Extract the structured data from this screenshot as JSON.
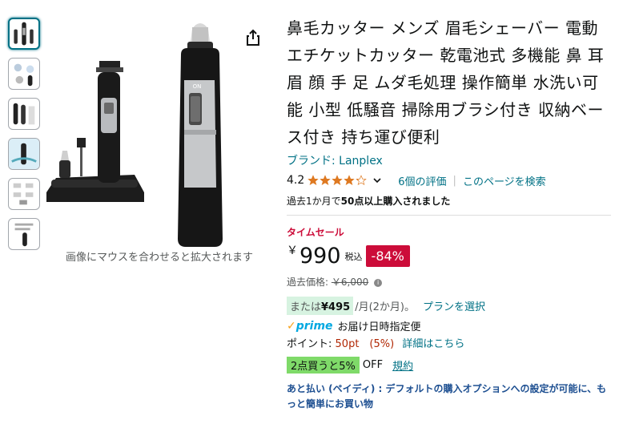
{
  "gallery": {
    "thumbnail_count": 6,
    "hover_note": "画像にマウスを合わせると拡大されます"
  },
  "product": {
    "title": "鼻毛カッター メンズ 眉毛シェーバー 電動 エチケットカッター 乾電池式 多機能 鼻 耳 眉 顔 手 足 ムダ毛処理 操作簡単 水洗い可能 小型 低騒音 掃除用ブラシ付き 収納ベース付き 持ち運び便利",
    "brand_link": "ブランド: Lanplex",
    "rating_value": "4.2",
    "rating_stars": 4.2,
    "reviews_link": "6個の評価",
    "separator": "|",
    "search_page_link": "このページを検索",
    "bought_prefix": "過去1か月で",
    "bought_bold": "50点以上購入されました"
  },
  "pricing": {
    "deal_label": "タイムセール",
    "currency": "￥",
    "price": "990",
    "tax_label": "税込",
    "discount": "-84%",
    "list_price_label": "過去価格:",
    "list_price": "￥6,000",
    "installment_prefix": "または",
    "installment_amount": "¥495",
    "installment_suffix": "/月(2か月)。",
    "plan_link": "プランを選択",
    "prime_label": "prime",
    "delivery_text": "お届け日時指定便",
    "points_label": "ポイント:",
    "points_value": "50pt　(5%)",
    "points_link": "詳細はこちら",
    "coupon_label": "2点買うと5%",
    "coupon_off": "OFF",
    "coupon_terms": "規約",
    "paidy_text": "あと払い (ペイディ) : デフォルトの購入オプションへの設定が可能に、もっと簡単にお買い物"
  },
  "colors": {
    "link": "#007185",
    "deal_red": "#cc0c39",
    "coupon_green": "#7fda69",
    "installment_bg": "#d7f3e1",
    "star": "#de7921"
  }
}
